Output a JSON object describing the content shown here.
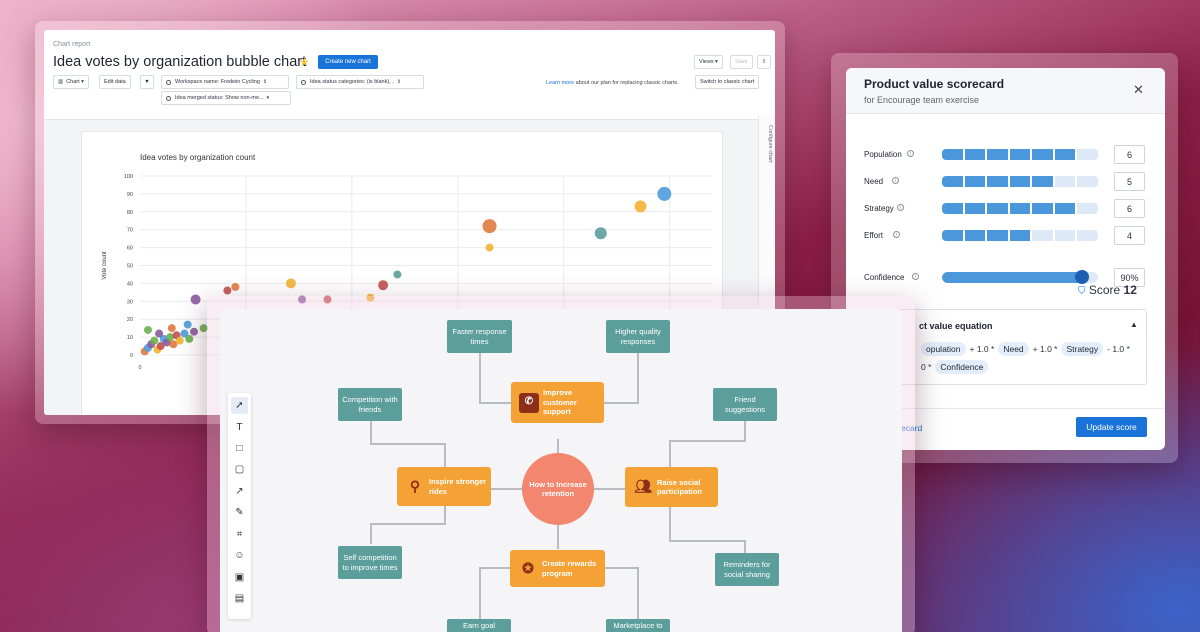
{
  "chart_report": {
    "crumb": "Chart report",
    "title": "Idea votes by organization bubble chart",
    "create_new_chart": "Create new chart",
    "chart_btn": "Chart ▾",
    "edit_data": "Edit data",
    "filter_workspace": "Workspace name: Fredwin Cycling",
    "filter_status": "Idea status categories: (is blank), ,",
    "filter_merged": "Idea merged status: Show non-me...",
    "learn_link": "Learn more",
    "learn_text": " about our plan for replacing classic charts.",
    "switch_classic": "Switch to classic chart",
    "views": "Views ▾",
    "save": "Save",
    "configure_chart": "Configure chart"
  },
  "chart_data": {
    "type": "scatter",
    "title": "Idea votes by organization count",
    "xlabel": "",
    "ylabel": "Vote count",
    "ylim": [
      0,
      100
    ],
    "y_ticks": [
      "0",
      "10",
      "20",
      "30",
      "40",
      "50",
      "60",
      "70",
      "80",
      "90",
      "100"
    ],
    "x_ticks": [
      "0"
    ],
    "points": [
      {
        "x": 0.3,
        "y": 2,
        "r": 4,
        "color": "#e07a3f"
      },
      {
        "x": 0.5,
        "y": 4,
        "r": 4,
        "color": "#4e9cde"
      },
      {
        "x": 0.7,
        "y": 6,
        "r": 4,
        "color": "#8a5a9c"
      },
      {
        "x": 0.9,
        "y": 8,
        "r": 4,
        "color": "#6ab04c"
      },
      {
        "x": 1.1,
        "y": 3,
        "r": 4,
        "color": "#f2b233"
      },
      {
        "x": 1.3,
        "y": 5,
        "r": 4,
        "color": "#c0504d"
      },
      {
        "x": 1.5,
        "y": 9,
        "r": 4,
        "color": "#4e9cde"
      },
      {
        "x": 1.7,
        "y": 7,
        "r": 4,
        "color": "#8a5a9c"
      },
      {
        "x": 1.9,
        "y": 10,
        "r": 4,
        "color": "#6ab04c"
      },
      {
        "x": 2.1,
        "y": 6,
        "r": 4,
        "color": "#e07a3f"
      },
      {
        "x": 2.3,
        "y": 11,
        "r": 4,
        "color": "#c0504d"
      },
      {
        "x": 2.5,
        "y": 8,
        "r": 4,
        "color": "#f2b233"
      },
      {
        "x": 2.8,
        "y": 12,
        "r": 4,
        "color": "#4e9cde"
      },
      {
        "x": 3.1,
        "y": 9,
        "r": 4,
        "color": "#6ab04c"
      },
      {
        "x": 3.4,
        "y": 13,
        "r": 4,
        "color": "#8a5a9c"
      },
      {
        "x": 0.5,
        "y": 14,
        "r": 4,
        "color": "#6ab04c"
      },
      {
        "x": 1.2,
        "y": 12,
        "r": 4,
        "color": "#8a5a9c"
      },
      {
        "x": 2.0,
        "y": 15,
        "r": 4,
        "color": "#e07a3f"
      },
      {
        "x": 3.0,
        "y": 17,
        "r": 4,
        "color": "#4e9cde"
      },
      {
        "x": 4.0,
        "y": 15,
        "r": 4,
        "color": "#6ab04c"
      },
      {
        "x": 3.5,
        "y": 31,
        "r": 5,
        "color": "#8a5a9c"
      },
      {
        "x": 5.5,
        "y": 36,
        "r": 4,
        "color": "#c0504d"
      },
      {
        "x": 6.0,
        "y": 38,
        "r": 4,
        "color": "#e07a3f"
      },
      {
        "x": 9.5,
        "y": 40,
        "r": 5,
        "color": "#f2b233"
      },
      {
        "x": 11.8,
        "y": 31,
        "r": 4,
        "color": "#c0504d"
      },
      {
        "x": 10.2,
        "y": 31,
        "r": 4,
        "color": "#8a5a9c"
      },
      {
        "x": 14.5,
        "y": 32,
        "r": 4,
        "color": "#f2b233"
      },
      {
        "x": 15.3,
        "y": 39,
        "r": 5,
        "color": "#c0504d"
      },
      {
        "x": 16.2,
        "y": 45,
        "r": 4,
        "color": "#5c9e9c"
      },
      {
        "x": 22.0,
        "y": 72,
        "r": 7,
        "color": "#e07a3f"
      },
      {
        "x": 22.0,
        "y": 60,
        "r": 4,
        "color": "#f2b233"
      },
      {
        "x": 29.0,
        "y": 68,
        "r": 6,
        "color": "#5c9e9c"
      },
      {
        "x": 31.5,
        "y": 83,
        "r": 6,
        "color": "#f2b233"
      },
      {
        "x": 33.0,
        "y": 90,
        "r": 7,
        "color": "#4e9cde"
      }
    ]
  },
  "scorecard": {
    "title": "Product value scorecard",
    "subtitle": "for Encourage team exercise",
    "criteria": [
      {
        "label": "Population",
        "value": "6",
        "filled": 6
      },
      {
        "label": "Need",
        "value": "5",
        "filled": 5
      },
      {
        "label": "Strategy",
        "value": "6",
        "filled": 6
      },
      {
        "label": "Effort",
        "value": "4",
        "filled": 4
      }
    ],
    "segments": 7,
    "confidence": {
      "label": "Confidence",
      "value": "90%",
      "fraction": 0.9
    },
    "score_label": "Score",
    "score_value": "12",
    "equation_title": "ct value equation",
    "eq_line1": {
      "t1": "opulation",
      "op1": "+ 1.0 *",
      "t2": "Need",
      "op2": "+ 1.0 *",
      "t3": "Strategy",
      "op3": "- 1.0 *"
    },
    "eq_line2": {
      "op": "0 *",
      "t": "Confidence"
    },
    "link_card": "ecard",
    "update_button": "Update score"
  },
  "mindmap": {
    "center": "How to Increase retention",
    "branches": [
      {
        "label": "Improve customer support",
        "icon": "phone-icon"
      },
      {
        "label": "Raise social participation",
        "icon": "group-icon"
      },
      {
        "label": "Create rewards program",
        "icon": "award-icon"
      },
      {
        "label": "Inspire stronger rides",
        "icon": "bike-icon"
      }
    ],
    "leaves": {
      "faster_response": "Faster response times",
      "higher_quality": "Higher quality responses",
      "friend_suggestions": "Friend suggestions",
      "reminders": "Reminders for social sharing",
      "earn_goal": "Earn goal",
      "marketplace": "Marketplace to",
      "competition_friends": "Competition with friends",
      "self_competition": "Self competition to improve times"
    }
  }
}
